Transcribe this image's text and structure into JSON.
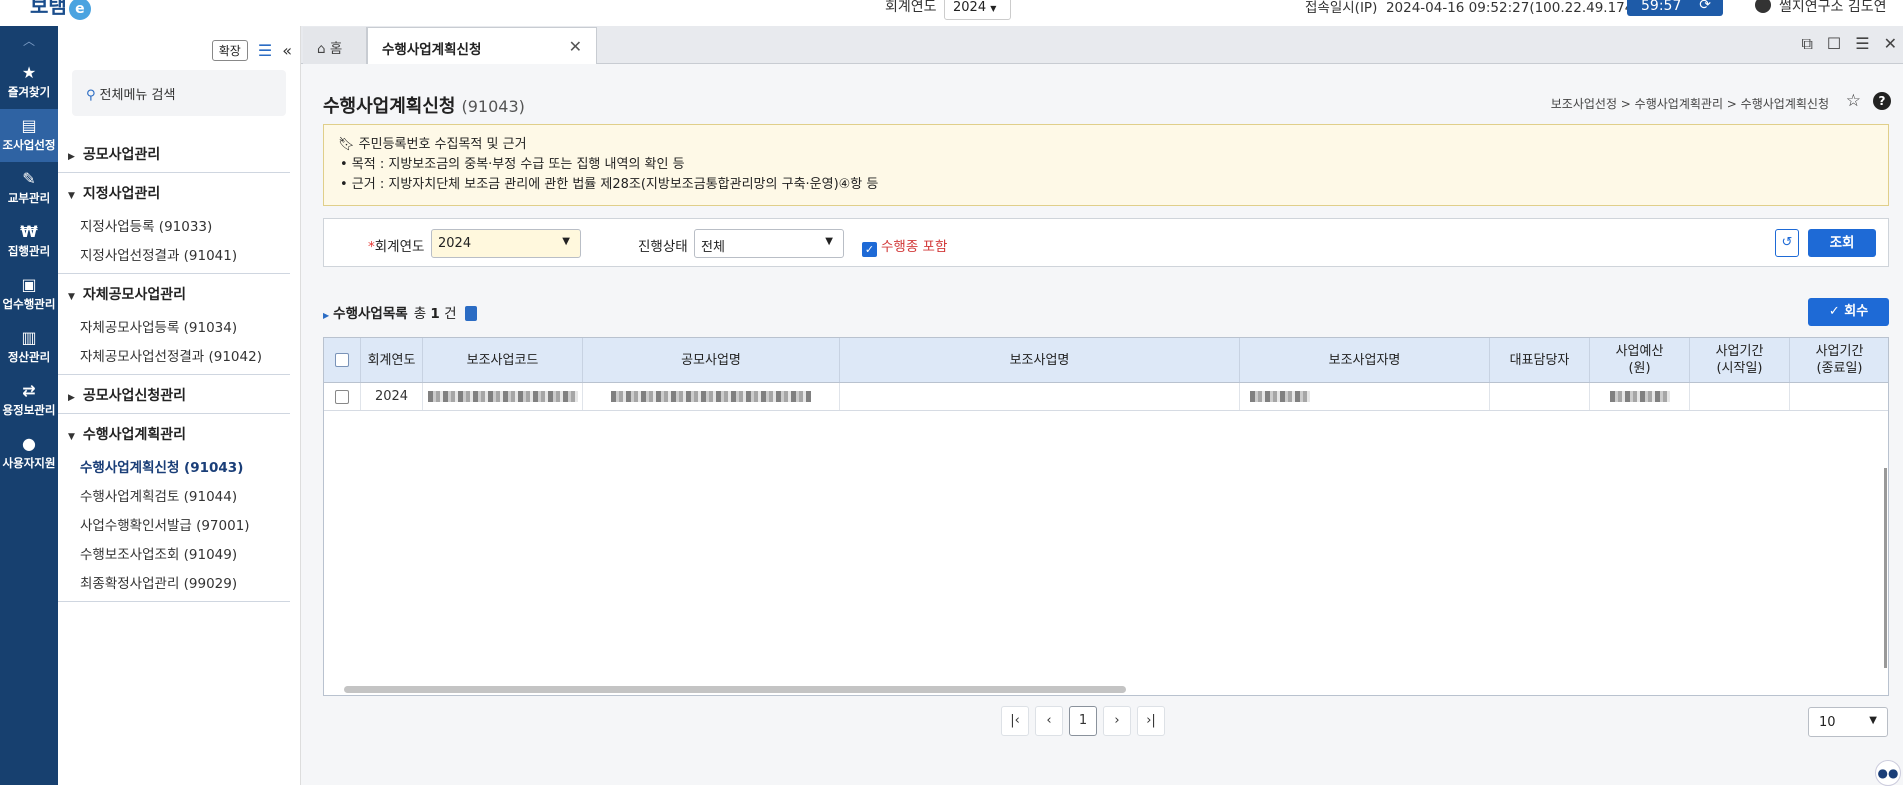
{
  "header": {
    "logo_text": "보탬",
    "logo_e": "e",
    "fiscal_year_label": "회계연도",
    "fiscal_year_value": "2024",
    "connection_label": "접속일시(IP)",
    "connection_value": "2024-04-16 09:52:27(100.22.49.174)",
    "timer": "59:57",
    "user": "썰지연구소 김도연"
  },
  "rail": {
    "items": [
      {
        "icon": "★",
        "label": "즐겨찾기"
      },
      {
        "icon": "▤",
        "label": "조사업선정"
      },
      {
        "icon": "✎",
        "label": "교부관리"
      },
      {
        "icon": "₩",
        "label": "집행관리"
      },
      {
        "icon": "▣",
        "label": "업수행관리"
      },
      {
        "icon": "▥",
        "label": "정산관리"
      },
      {
        "icon": "⇄",
        "label": "용정보관리"
      },
      {
        "icon": "●",
        "label": "사용자지원"
      }
    ]
  },
  "sidebar": {
    "expand_label": "확장",
    "search_placeholder": "전체메뉴 검색",
    "groups": [
      {
        "label": "공모사업관리",
        "open": false,
        "items": []
      },
      {
        "label": "지정사업관리",
        "open": true,
        "items": [
          "지정사업등록 (91033)",
          "지정사업선정결과 (91041)"
        ]
      },
      {
        "label": "자체공모사업관리",
        "open": true,
        "items": [
          "자체공모사업등록 (91034)",
          "자체공모사업선정결과 (91042)"
        ]
      },
      {
        "label": "공모사업신청관리",
        "open": false,
        "items": []
      },
      {
        "label": "수행사업계획관리",
        "open": true,
        "items": [
          "수행사업계획신청 (91043)",
          "수행사업계획검토 (91044)",
          "사업수행확인서발급 (97001)",
          "수행보조사업조회 (91049)",
          "최종확정사업관리 (99029)"
        ]
      }
    ]
  },
  "tabs": {
    "home": "홈",
    "current": "수행사업계획신청"
  },
  "page": {
    "title": "수행사업계획신청",
    "code": "(91043)",
    "breadcrumb": "보조사업선정 > 수행사업계획관리 > 수행사업계획신청"
  },
  "notice": {
    "title": "주민등록번호 수집목적 및 근거",
    "line1": "• 목적 : 지방보조금의 중복·부정 수급 또는 집행 내역의 확인 등",
    "line2": "• 근거 : 지방자치단체 보조금 관리에 관한 법률 제28조(지방보조금통합관리망의 구축·운영)④항 등"
  },
  "filter": {
    "year_label": "회계연도",
    "year_value": "2024",
    "status_label": "진행상태",
    "status_value": "전체",
    "include_label": "수행종 포함",
    "search_label": "조회"
  },
  "list": {
    "title": "수행사업목록",
    "count_prefix": "총",
    "count": "1",
    "count_suffix": "건",
    "return_label": "회수",
    "columns": [
      "회계연도",
      "보조사업코드",
      "공모사업명",
      "보조사업명",
      "보조사업자명",
      "대표담당자",
      "사업예산\n(원)",
      "사업기간\n(시작일)",
      "사업기간\n(종료일)"
    ],
    "rows": [
      {
        "year": "2024"
      }
    ]
  },
  "pager": {
    "current": "1",
    "page_size": "10"
  },
  "colors": {
    "rail_bg": "#17406f",
    "accent": "#1e6ad6",
    "notice_bg": "#fef9e7",
    "grid_head": "#dde8f7"
  }
}
